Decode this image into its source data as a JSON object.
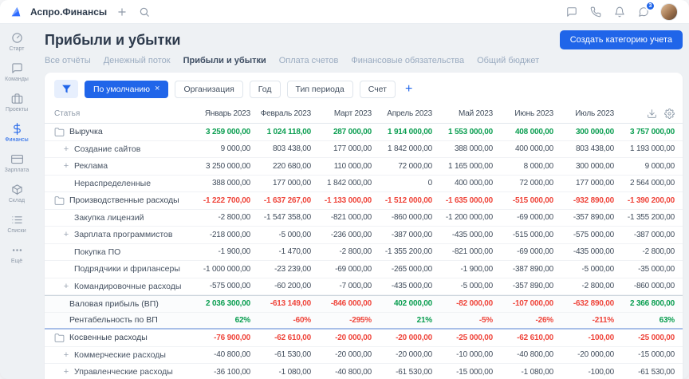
{
  "topbar": {
    "app_name": "Аспро.Финансы",
    "icons": [
      {
        "name": "support"
      },
      {
        "name": "phone"
      },
      {
        "name": "bell"
      },
      {
        "name": "chat",
        "badge": "3"
      }
    ],
    "badge_count": "3"
  },
  "sidebar": {
    "items": [
      {
        "label": "Старт",
        "icon": "start",
        "active": false
      },
      {
        "label": "Команды",
        "icon": "teams",
        "active": false
      },
      {
        "label": "Проекты",
        "icon": "projects",
        "active": false
      },
      {
        "label": "Финансы",
        "icon": "finance",
        "active": true
      },
      {
        "label": "Зарплата",
        "icon": "salary",
        "active": false
      },
      {
        "label": "Склад",
        "icon": "warehouse",
        "active": false
      },
      {
        "label": "Списки",
        "icon": "lists",
        "active": false
      },
      {
        "label": "Ещё",
        "icon": "more",
        "active": false
      }
    ]
  },
  "page": {
    "title": "Прибыли и убытки",
    "create_button": "Создать категорию учета"
  },
  "tabs": [
    {
      "label": "Все отчёты",
      "active": false
    },
    {
      "label": "Денежный поток",
      "active": false
    },
    {
      "label": "Прибыли и убытки",
      "active": true
    },
    {
      "label": "Оплата счетов",
      "active": false
    },
    {
      "label": "Финансовые обязательства",
      "active": false
    },
    {
      "label": "Общий бюджет",
      "active": false
    }
  ],
  "filters": {
    "default_chip": "По умолчанию",
    "chips": [
      "Организация",
      "Год",
      "Тип периода",
      "Счет"
    ]
  },
  "table": {
    "first_col_header": "Статья",
    "months": [
      "Январь 2023",
      "Февраль 2023",
      "Март 2023",
      "Апрель 2023",
      "Май 2023",
      "Июнь 2023",
      "Июль 2023"
    ],
    "header_icons": [
      {
        "name": "download-icon"
      },
      {
        "name": "gear-icon"
      }
    ],
    "rows": [
      {
        "label": "Выручка",
        "style": "section",
        "color": "green",
        "values": [
          "3 259 000,00",
          "1 024 118,00",
          "287 000,00",
          "1 914 000,00",
          "1 553 000,00",
          "408 000,00",
          "300 000,00",
          "3 757 000,00"
        ]
      },
      {
        "label": "Создание сайтов",
        "style": "child",
        "plus": true,
        "color": "default",
        "values": [
          "9 000,00",
          "803 438,00",
          "177 000,00",
          "1 842 000,00",
          "388 000,00",
          "400 000,00",
          "803 438,00",
          "1 193 000,00"
        ]
      },
      {
        "label": "Реклама",
        "style": "child",
        "plus": true,
        "color": "default",
        "values": [
          "3 250 000,00",
          "220 680,00",
          "110 000,00",
          "72 000,00",
          "1 165 000,00",
          "8 000,00",
          "300 000,00",
          "9 000,00"
        ]
      },
      {
        "label": "Нераспределенные",
        "style": "child",
        "plus": false,
        "color": "default",
        "values": [
          "388 000,00",
          "177 000,00",
          "1 842 000,00",
          "0",
          "400 000,00",
          "72 000,00",
          "177 000,00",
          "2 564 000,00"
        ]
      },
      {
        "label": "Производственные расходы",
        "style": "section",
        "color": "red",
        "values": [
          "-1 222 700,00",
          "-1 637 267,00",
          "-1 133 000,00",
          "-1 512 000,00",
          "-1 635 000,00",
          "-515 000,00",
          "-932 890,00",
          "-1 390 200,00"
        ]
      },
      {
        "label": "Закупка лицензий",
        "style": "child",
        "plus": false,
        "color": "default",
        "values": [
          "-2 800,00",
          "-1 547 358,00",
          "-821 000,00",
          "-860 000,00",
          "-1 200 000,00",
          "-69 000,00",
          "-357 890,00",
          "-1 355 200,00"
        ]
      },
      {
        "label": "Зарплата программистов",
        "style": "child",
        "plus": true,
        "color": "default",
        "values": [
          "-218 000,00",
          "-5 000,00",
          "-236 000,00",
          "-387 000,00",
          "-435 000,00",
          "-515 000,00",
          "-575 000,00",
          "-387 000,00"
        ]
      },
      {
        "label": "Покупка ПО",
        "style": "child",
        "plus": false,
        "color": "default",
        "values": [
          "-1 900,00",
          "-1 470,00",
          "-2 800,00",
          "-1 355 200,00",
          "-821 000,00",
          "-69 000,00",
          "-435 000,00",
          "-2 800,00"
        ]
      },
      {
        "label": "Подрядчики и фрилансеры",
        "style": "child",
        "plus": false,
        "color": "default",
        "values": [
          "-1 000 000,00",
          "-23 239,00",
          "-69 000,00",
          "-265 000,00",
          "-1 900,00",
          "-387 890,00",
          "-5 000,00",
          "-35 000,00"
        ]
      },
      {
        "label": "Командировочные расходы",
        "style": "child",
        "plus": true,
        "color": "default",
        "values": [
          "-575 000,00",
          "-60 200,00",
          "-7 000,00",
          "-435 000,00",
          "-5 000,00",
          "-357 890,00",
          "-2 800,00",
          "-860 000,00"
        ]
      },
      {
        "label": "Валовая прибыль (ВП)",
        "style": "gross",
        "color": "auto",
        "values": [
          "2 036 300,00",
          "-613 149,00",
          "-846 000,00",
          "402 000,00",
          "-82 000,00",
          "-107 000,00",
          "-632 890,00",
          "2 366 800,00"
        ]
      },
      {
        "label": "Рентабельность по ВП",
        "style": "ratio",
        "color": "auto",
        "values": [
          "62%",
          "-60%",
          "-295%",
          "21%",
          "-5%",
          "-26%",
          "-211%",
          "63%"
        ]
      },
      {
        "label": "Косвенные расходы",
        "style": "section",
        "color": "red",
        "values": [
          "-76 900,00",
          "-62 610,00",
          "-20 000,00",
          "-20 000,00",
          "-25 000,00",
          "-62 610,00",
          "-100,00",
          "-25 000,00"
        ]
      },
      {
        "label": "Коммерческие расходы",
        "style": "child",
        "plus": true,
        "color": "default",
        "values": [
          "-40 800,00",
          "-61 530,00",
          "-20 000,00",
          "-20 000,00",
          "-10 000,00",
          "-40 800,00",
          "-20 000,00",
          "-15 000,00"
        ]
      },
      {
        "label": "Управленческие расходы",
        "style": "child",
        "plus": true,
        "color": "default",
        "values": [
          "-36 100,00",
          "-1 080,00",
          "-40 800,00",
          "-61 530,00",
          "-15 000,00",
          "-1 080,00",
          "-100,00",
          "-61 530,00"
        ]
      }
    ]
  },
  "colors": {
    "accent": "#2065e9",
    "positive": "#0b9e51",
    "negative": "#ef463c",
    "month_header": "#4a80d9"
  }
}
